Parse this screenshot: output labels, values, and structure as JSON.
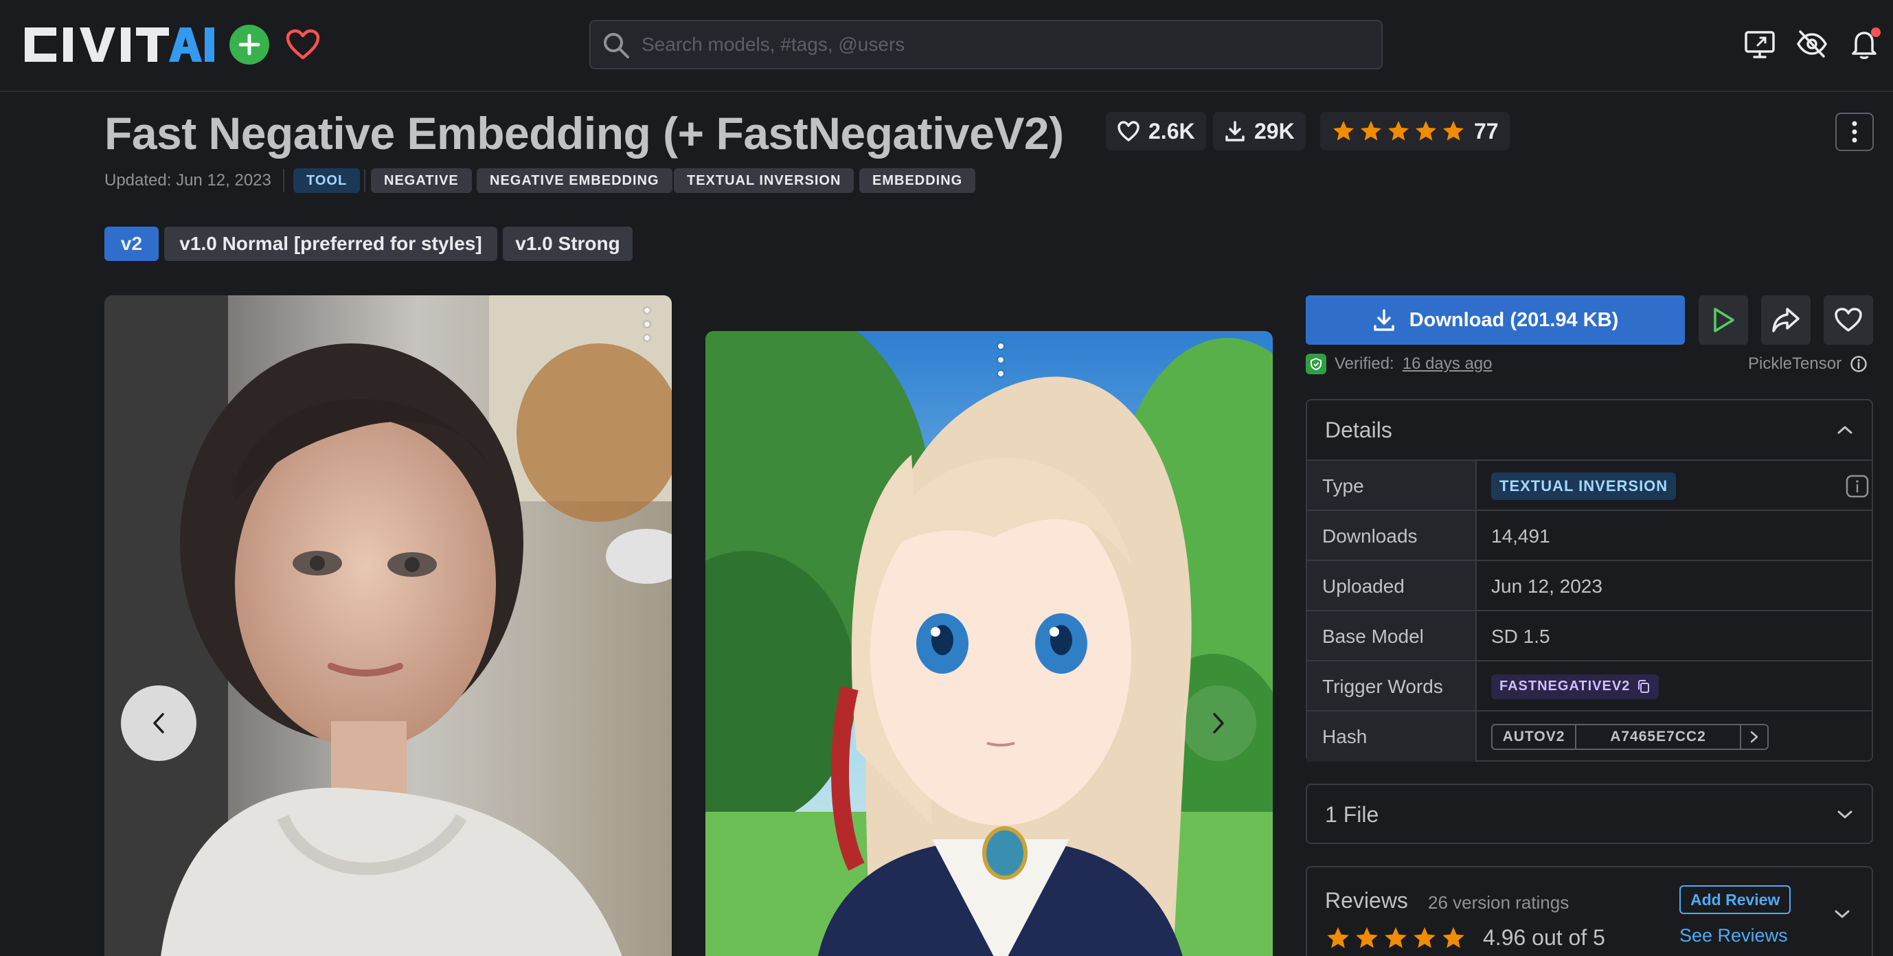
{
  "header": {
    "logo_text": "CIVITAI",
    "search": {
      "placeholder": "Search models, #tags, @users",
      "value": ""
    },
    "icons": [
      "plus-icon",
      "heart-icon",
      "search-icon",
      "monitor-icon",
      "eye-off-icon",
      "bell-icon"
    ]
  },
  "model": {
    "title": "Fast Negative Embedding (+ FastNegativeV2)",
    "likes": "2.6K",
    "downloads": "29K",
    "rating_count": "77",
    "rating_stars": 5,
    "updated": "Updated: Jun 12, 2023",
    "tags": [
      "TOOL",
      "NEGATIVE",
      "NEGATIVE EMBEDDING",
      "TEXTUAL INVERSION",
      "EMBEDDING"
    ]
  },
  "versions": [
    {
      "label": "v2",
      "active": true
    },
    {
      "label": "v1.0 Normal [preferred for styles]",
      "active": false
    },
    {
      "label": "v1.0 Strong",
      "active": false
    }
  ],
  "sidebar": {
    "download_label": "Download (201.94 KB)",
    "verified_label": "Verified:",
    "verified_when": "16 days ago",
    "scanner": "PickleTensor",
    "details": {
      "title": "Details",
      "rows": [
        {
          "label": "Type",
          "value": "TEXTUAL INVERSION"
        },
        {
          "label": "Downloads",
          "value": "14,491"
        },
        {
          "label": "Uploaded",
          "value": "Jun 12, 2023"
        },
        {
          "label": "Base Model",
          "value": "SD 1.5"
        },
        {
          "label": "Trigger Words",
          "value": "FASTNEGATIVEV2"
        },
        {
          "label": "Hash",
          "hash_type": "AUTOV2",
          "value": "A7465E7CC2"
        }
      ]
    },
    "files_title": "1 File",
    "reviews": {
      "title": "Reviews",
      "count": "26 version ratings",
      "score": "4.96 out of 5",
      "stars": 5,
      "add_review": "Add Review",
      "see_reviews": "See Reviews"
    }
  },
  "colors": {
    "background": "#1a1b1e",
    "accent_blue": "#2f6fcb",
    "star": "#f08c00",
    "brand_green": "#37b24d",
    "heart": "#fa5252"
  }
}
